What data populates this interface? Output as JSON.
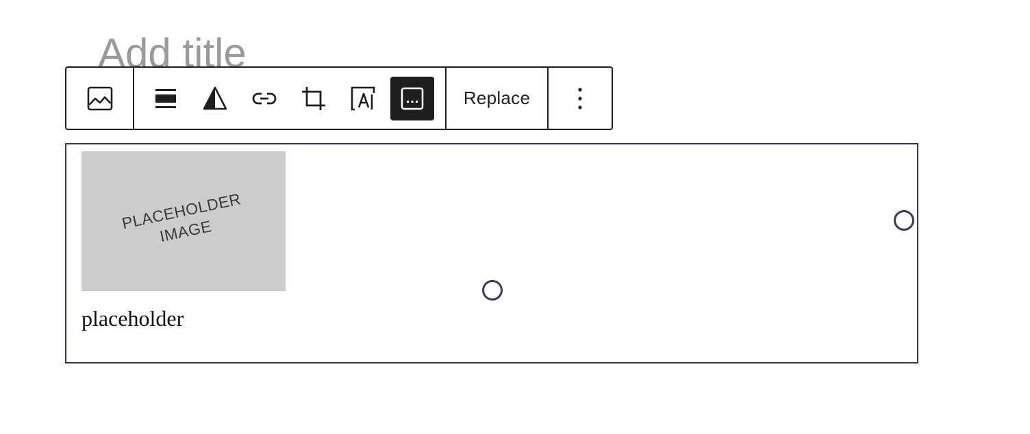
{
  "editor": {
    "title_placeholder": "Add title"
  },
  "toolbar": {
    "buttons": [
      {
        "name": "image-block-icon",
        "label": "Image"
      },
      {
        "name": "align-icon",
        "label": "Align"
      },
      {
        "name": "duotone-icon",
        "label": "Apply duotone filter"
      },
      {
        "name": "link-icon",
        "label": "Insert link"
      },
      {
        "name": "crop-icon",
        "label": "Crop"
      },
      {
        "name": "text-over-image-icon",
        "label": "Add text over image"
      },
      {
        "name": "caption-icon",
        "label": "Caption",
        "active": true
      }
    ],
    "replace_label": "Replace",
    "more_options_icon": "more-vertical-icon"
  },
  "image_block": {
    "placeholder_line1": "PLACEHOLDER",
    "placeholder_line2": "IMAGE",
    "caption": "placeholder"
  },
  "colors": {
    "selection_border": "#3b3565",
    "toolbar_border": "#1e1e1e",
    "active_button_bg": "#1e1e1e",
    "placeholder_bg": "#cccccc",
    "title_placeholder": "#9a9a9a"
  }
}
